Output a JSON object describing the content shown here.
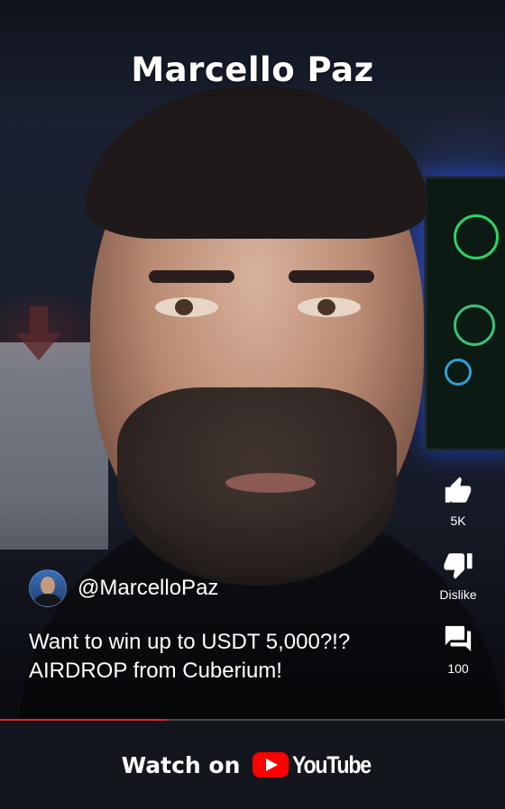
{
  "video": {
    "title": "Marcello Paz",
    "channel_handle": "@MarcelloPaz",
    "caption": "Want to win up to USDT 5,000?!? AIRDROP from Cuberium!",
    "progress_fraction": 0.33
  },
  "actions": [
    {
      "icon": "thumbs-up-icon",
      "label": "5K"
    },
    {
      "icon": "thumbs-down-icon",
      "label": "Dislike"
    },
    {
      "icon": "comments-icon",
      "label": "100"
    }
  ],
  "footer": {
    "watch_on_label": "Watch on",
    "youtube_wordmark": "YouTube",
    "brand_color": "#ff0000"
  }
}
